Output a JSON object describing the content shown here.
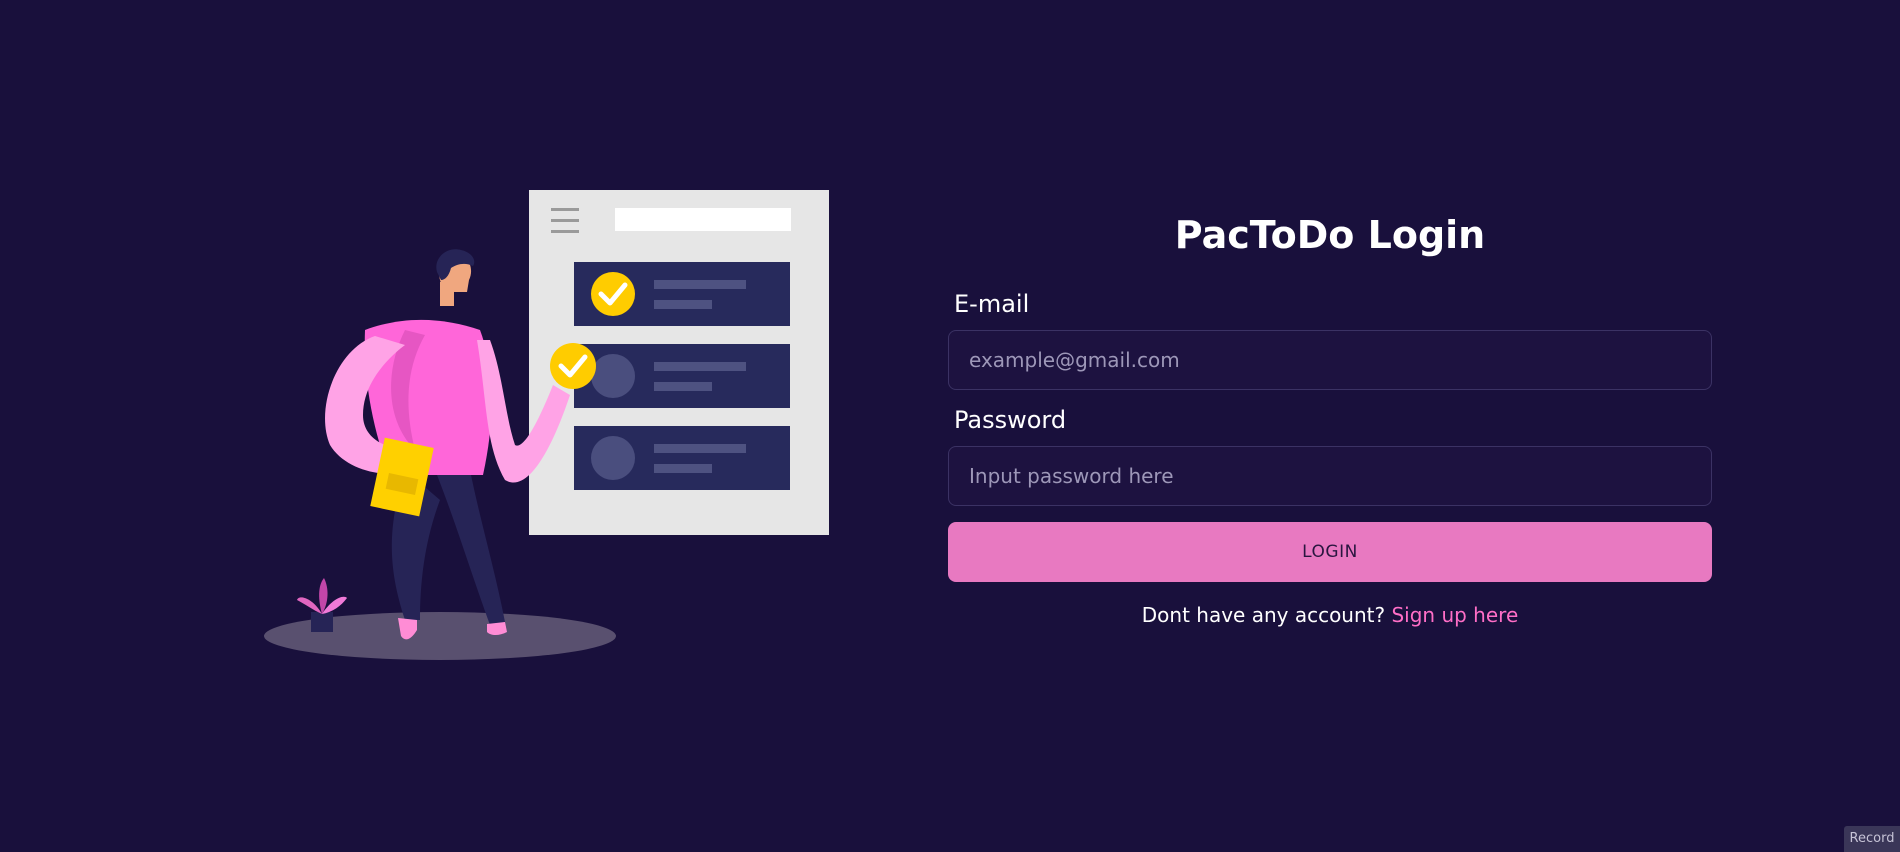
{
  "login": {
    "title": "PacToDo Login",
    "email_label": "E-mail",
    "email_placeholder": "example@gmail.com",
    "email_value": "",
    "password_label": "Password",
    "password_placeholder": "Input password here",
    "password_value": "",
    "login_button": "LOGIN",
    "signup_prompt": "Dont have any account?",
    "signup_link": "Sign up here"
  },
  "record_tag": "Record",
  "colors": {
    "background": "#19103c",
    "accent": "#e879c1",
    "link": "#ff6ec7",
    "input_background": "#1d1240"
  },
  "illustration": {
    "icons": [
      "hamburger-menu-icon",
      "checkmark-icon",
      "plant-icon",
      "clipboard-icon"
    ]
  }
}
